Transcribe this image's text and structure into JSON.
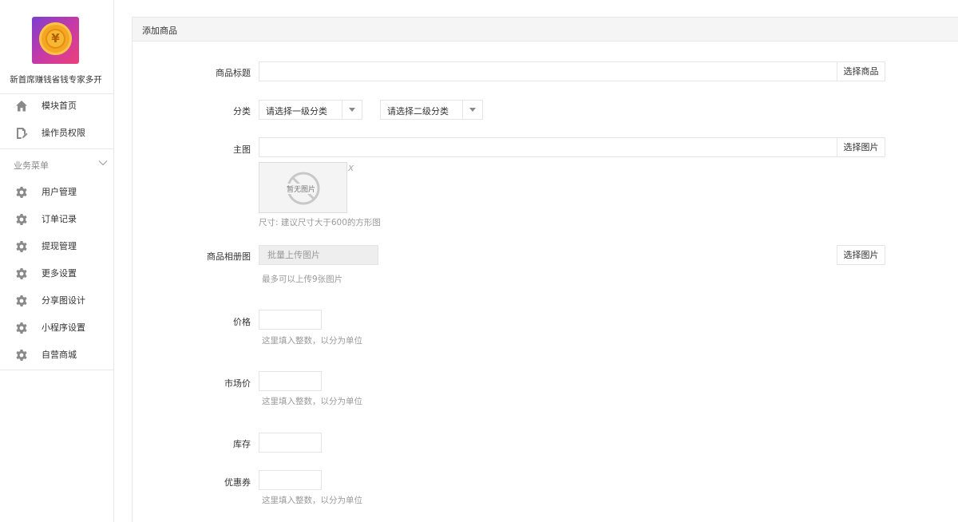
{
  "app": {
    "name": "新首席赚钱省钱专家多开",
    "logo_symbol": "¥"
  },
  "sidebar": {
    "top_items": [
      {
        "label": "模块首页",
        "icon": "home-icon"
      },
      {
        "label": "操作员权限",
        "icon": "edit-doc-icon"
      }
    ],
    "section_label": "业务菜单",
    "items": [
      {
        "label": "用户管理",
        "icon": "gear-icon"
      },
      {
        "label": "订单记录",
        "icon": "gear-icon"
      },
      {
        "label": "提现管理",
        "icon": "gear-icon"
      },
      {
        "label": "更多设置",
        "icon": "gear-icon"
      },
      {
        "label": "分享图设计",
        "icon": "gear-icon"
      },
      {
        "label": "小程序设置",
        "icon": "gear-icon"
      },
      {
        "label": "自营商城",
        "icon": "gear-icon"
      }
    ]
  },
  "panel": {
    "title": "添加商品"
  },
  "form": {
    "title": {
      "label": "商品标题",
      "value": "",
      "button": "选择商品"
    },
    "category": {
      "label": "分类",
      "level1": "请选择一级分类",
      "level2": "请选择二级分类"
    },
    "main_image": {
      "label": "主图",
      "value": "",
      "button": "选择图片",
      "placeholder_text": "暂无图片",
      "close": "x",
      "hint": "尺寸: 建议尺寸大于600的方形图"
    },
    "album": {
      "label": "商品相册图",
      "upload": "批量上传图片",
      "button": "选择图片",
      "hint": "最多可以上传9张图片"
    },
    "price": {
      "label": "价格",
      "value": "",
      "hint": "这里填入整数，以分为单位"
    },
    "market_price": {
      "label": "市场价",
      "value": "",
      "hint": "这里填入整数，以分为单位"
    },
    "stock": {
      "label": "库存",
      "value": ""
    },
    "coupon": {
      "label": "优惠券",
      "value": "",
      "hint": "这里填入整数，以分为单位"
    }
  },
  "colors": {
    "icon_gray": "#8a8a8a",
    "border": "#e5e5e5",
    "hint": "#999999"
  }
}
